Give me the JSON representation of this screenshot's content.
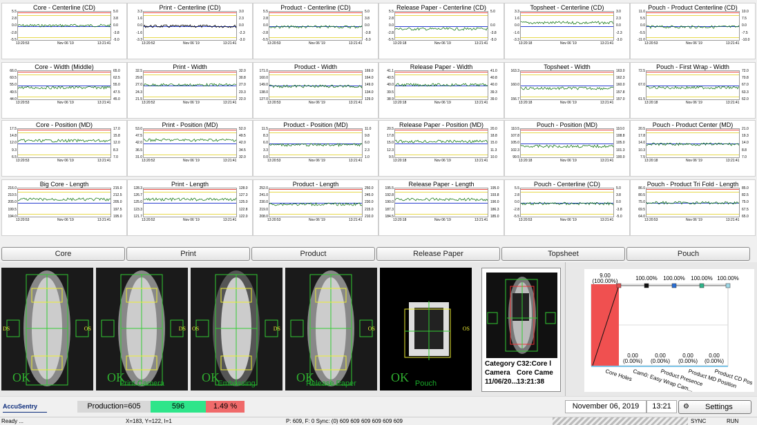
{
  "charts": [
    {
      "title": "Core - Centerline (CD)",
      "yl": [
        "5.5",
        "2.8",
        "0.0",
        "-2.8",
        "-5.5"
      ],
      "yr": [
        "5.0",
        "3.8",
        "0.0",
        "-3.8",
        "-5.0"
      ],
      "x0": "13:20:53",
      "xm": "Nov 06 '19",
      "x1": "13:21:41",
      "trace": "#1a7a1a"
    },
    {
      "title": "Print - Centerline (CD)",
      "yl": [
        "3.3",
        "1.6",
        "0.0",
        "-1.6",
        "-3.3"
      ],
      "yr": [
        "3.0",
        "2.3",
        "0.0",
        "-2.3",
        "-3.0"
      ],
      "x0": "13:20:52",
      "xm": "Nov 06 '19",
      "x1": "13:21:41",
      "trace": "#000000"
    },
    {
      "title": "Product - Centerline (CD)",
      "yl": [
        "5.5",
        "2.8",
        "0.0",
        "-2.8",
        "-5.5"
      ],
      "yr": [
        "5.0",
        "3.8",
        "0.0",
        "-3.8",
        "-5.0"
      ],
      "x0": "13:20:53",
      "xm": "Nov 06 '19",
      "x1": "13:21:41",
      "trace": "#1a7a1a"
    },
    {
      "title": "Release Paper - Centerline (CD)",
      "yl": [
        "5.5",
        "2.8",
        "0.0",
        "-2.8",
        "-5.5"
      ],
      "yr": [
        "5.0",
        "",
        "0.0",
        "-3.8",
        "-5.0"
      ],
      "x0": "13:20:18",
      "xm": "Nov 06 '19",
      "x1": "13:21:41",
      "trace": "#1a7a1a"
    },
    {
      "title": "Topsheet - Centerline (CD)",
      "yl": [
        "3.3",
        "1.6",
        "0.0",
        "-1.6",
        "-3.3"
      ],
      "yr": [
        "3.0",
        "2.3",
        "0.0",
        "-2.3",
        "-3.0"
      ],
      "x0": "13:20:18",
      "xm": "Nov 06 '19",
      "x1": "13:21:41",
      "trace": "#1a7a1a"
    },
    {
      "title": "Pouch - Product Centerline (CD)",
      "yl": [
        "11.0",
        "5.5",
        "0.0",
        "-5.5",
        "-11.0"
      ],
      "yr": [
        "10.0",
        "7.5",
        "0.0",
        "-7.5",
        "-10.0"
      ],
      "x0": "13:20:53",
      "xm": "Nov 06 '19",
      "x1": "13:21:41",
      "trace": "#1a7a1a"
    },
    {
      "title": "Core - Width (Middle)",
      "yl": [
        "66.0",
        "60.5",
        "55.0",
        "49.5",
        "44.0"
      ],
      "yr": [
        "65.0",
        "62.5",
        "55.0",
        "47.5",
        "45.0"
      ],
      "x0": "13:20:53",
      "xm": "Nov 06 '19",
      "x1": "13:21:41",
      "trace": "#1a7a1a"
    },
    {
      "title": "Print - Width",
      "yl": [
        "32.5",
        "29.8",
        "27.0",
        "24.3",
        "21.5"
      ],
      "yr": [
        "32.0",
        "30.8",
        "27.0",
        "23.3",
        "22.0"
      ],
      "x0": "13:20:52",
      "xm": "Nov 06 '19",
      "x1": "13:21:41",
      "trace": "#1a7a1a"
    },
    {
      "title": "Product - Width",
      "yl": [
        "171.0",
        "160.0",
        "149.0",
        "138.0",
        "127.0"
      ],
      "yr": [
        "169.0",
        "164.0",
        "149.0",
        "134.0",
        "129.0"
      ],
      "x0": "13:20:53",
      "xm": "Nov 06 '19",
      "x1": "13:21:41",
      "trace": "#1a7a1a"
    },
    {
      "title": "Release Paper - Width",
      "yl": [
        "41.1",
        "40.5",
        "40.0",
        "39.5",
        "38.9"
      ],
      "yr": [
        "41.0",
        "40.8",
        "40.0",
        "39.3",
        "39.0"
      ],
      "x0": "13:20:18",
      "xm": "Nov 06 '19",
      "x1": "13:21:41",
      "trace": "#1a7a1a"
    },
    {
      "title": "Topsheet - Width",
      "yl": [
        "163.3",
        "",
        "160.0",
        "",
        "156.7"
      ],
      "yr": [
        "163.0",
        "162.3",
        "160.0",
        "157.8",
        "157.0"
      ],
      "x0": "13:20:18",
      "xm": "Nov 06 '19",
      "x1": "13:21:41",
      "trace": "#1a7a1a"
    },
    {
      "title": "Pouch - First Wrap - Width",
      "yl": [
        "72.5",
        "",
        "67.0",
        "",
        "61.5"
      ],
      "yr": [
        "72.0",
        "70.8",
        "67.0",
        "63.3",
        "62.0"
      ],
      "x0": "13:20:18",
      "xm": "Nov 06 '19",
      "x1": "13:21:41",
      "trace": "#1a7a1a"
    },
    {
      "title": "Core - Position (MD)",
      "yl": [
        "17.5",
        "14.8",
        "12.0",
        "9.3",
        "6.5"
      ],
      "yr": [
        "17.0",
        "15.8",
        "12.0",
        "8.3",
        "7.0"
      ],
      "x0": "13:20:53",
      "xm": "Nov 06 '19",
      "x1": "13:21:41",
      "trace": "#1a7a1a"
    },
    {
      "title": "Print - Position (MD)",
      "yl": [
        "53.0",
        "47.5",
        "42.0",
        "36.5",
        "31.0"
      ],
      "yr": [
        "52.0",
        "49.5",
        "42.0",
        "34.5",
        "32.0"
      ],
      "x0": "13:20:52",
      "xm": "Nov 06 '19",
      "x1": "13:21:41",
      "trace": "#1a7a1a"
    },
    {
      "title": "Product - Position (MD)",
      "yl": [
        "11.5",
        "8.3",
        "6.0",
        "3.3",
        "0.0"
      ],
      "yr": [
        "11.0",
        "9.8",
        "6.0",
        "2.3",
        "1.0"
      ],
      "x0": "13:20:53",
      "xm": "Nov 06 '19",
      "x1": "13:21:41",
      "trace": "#1a7a1a"
    },
    {
      "title": "Release Paper - Position (MD)",
      "yl": [
        "20.5",
        "17.8",
        "15.0",
        "12.3",
        "9.5"
      ],
      "yr": [
        "20.0",
        "18.8",
        "15.0",
        "11.3",
        "10.0"
      ],
      "x0": "13:20:18",
      "xm": "Nov 06 '19",
      "x1": "13:21:41",
      "trace": "#1a7a1a"
    },
    {
      "title": "Pouch - Position (MD)",
      "yl": [
        "110.5",
        "107.8",
        "105.0",
        "102.3",
        "99.5"
      ],
      "yr": [
        "110.0",
        "108.8",
        "105.0",
        "101.3",
        "100.0"
      ],
      "x0": "13:20:18",
      "xm": "Nov 06 '19",
      "x1": "13:21:41",
      "trace": "#1a7a1a"
    },
    {
      "title": "Pouch - Product Center  (MD)",
      "yl": [
        "20.5",
        "17.8",
        "14.0",
        "10.3",
        "7.5"
      ],
      "yr": [
        "21.0",
        "19.3",
        "14.0",
        "8.8",
        "7.0"
      ],
      "x0": "13:20:18",
      "xm": "Nov 06 '19",
      "x1": "13:21:41",
      "trace": "#1a7a1a"
    },
    {
      "title": "Big Core - Length",
      "yl": [
        "216.0",
        "210.5",
        "205.0",
        "199.5",
        "194.0"
      ],
      "yr": [
        "215.0",
        "212.5",
        "205.0",
        "197.5",
        "195.0"
      ],
      "x0": "13:20:53",
      "xm": "Nov 06 '19",
      "x1": "13:21:41",
      "trace": "#1a7a1a"
    },
    {
      "title": "Print - Length",
      "yl": [
        "128.3",
        "126.7",
        "125.0",
        "123.3",
        "121.7"
      ],
      "yr": [
        "128.0",
        "127.3",
        "125.0",
        "122.8",
        "122.0"
      ],
      "x0": "13:20:52",
      "xm": "Nov 06 '19",
      "x1": "13:21:41",
      "trace": "#1a7a1a"
    },
    {
      "title": "Product - Length",
      "yl": [
        "252.0",
        "241.0",
        "230.0",
        "219.0",
        "208.0"
      ],
      "yr": [
        "250.0",
        "245.0",
        "230.0",
        "215.0",
        "210.0"
      ],
      "x0": "13:20:53",
      "xm": "Nov 06 '19",
      "x1": "13:21:41",
      "trace": "#1a7a1a"
    },
    {
      "title": "Release Paper - Length",
      "yl": [
        "195.5",
        "192.8",
        "190.0",
        "187.3",
        "184.5"
      ],
      "yr": [
        "195.0",
        "193.8",
        "190.0",
        "186.3",
        "185.0"
      ],
      "x0": "13:20:18",
      "xm": "Nov 06 '19",
      "x1": "13:21:41",
      "trace": "#1a7a1a"
    },
    {
      "title": "Pouch - Centerline (CD)",
      "yl": [
        "5.5",
        "2.8",
        "0.0",
        "-2.8",
        "-5.5"
      ],
      "yr": [
        "5.0",
        "3.8",
        "0.0",
        "-3.8",
        "-5.0"
      ],
      "x0": "13:20:53",
      "xm": "Nov 06 '19",
      "x1": "13:21:41",
      "trace": "#1a7a1a"
    },
    {
      "title": "Pouch - Product Tri Fold - Length",
      "yl": [
        "86.0",
        "80.5",
        "75.0",
        "69.5",
        "64.0"
      ],
      "yr": [
        "85.0",
        "82.5",
        "75.0",
        "67.5",
        "65.0"
      ],
      "x0": "13:20:53",
      "xm": "Nov 06 '19",
      "x1": "13:21:41",
      "trace": "#1a7a1a"
    }
  ],
  "tabs": [
    "Core",
    "Print",
    "Product",
    "Release Paper",
    "Topsheet",
    "Pouch"
  ],
  "cameras": [
    {
      "name": "",
      "status": "OK",
      "side_left": "DS",
      "side_right": "OS"
    },
    {
      "name": "Print Camera",
      "status": "OK",
      "side_left": "",
      "side_right": "DS"
    },
    {
      "name": "Embossing",
      "status": "OK",
      "side_left": "OS",
      "side_right": "DS"
    },
    {
      "name": "Release Paper",
      "status": "OK",
      "side_left": "",
      "side_right": "OS"
    },
    {
      "name": "Pouch",
      "status": "OK",
      "side_left": "",
      "side_right": "OS"
    }
  ],
  "detail": {
    "category_label": "Category",
    "category_value": "C32:Core l",
    "camera_label": "Camera",
    "camera_value": "Core Came",
    "date": "11/06/20...",
    "time": "13:21:38"
  },
  "summary_chart": {
    "categories": [
      "Core Holes",
      "Cam0: Easy Wrap Cam...",
      "Product Presence",
      "Product MD Position",
      "Product CD Pos"
    ],
    "top_labels": [
      "9.00\n(100.00%)",
      "100.00%",
      "100.00%",
      "100.00%",
      "100.00%"
    ],
    "bottom_labels": [
      "",
      "0.00\n(0.00%)",
      "0.00\n(0.00%)",
      "0.00\n(0.00%)",
      "0.00\n(0.00%)"
    ],
    "marker_colors": [
      "#e05050",
      "#111111",
      "#2a6fd6",
      "#2fb58a",
      "#9fd9e8"
    ]
  },
  "footer": {
    "logo": "AccuSentry",
    "production": "Production=605",
    "good": "596",
    "reject": "1.49 %",
    "date": "November 06, 2019",
    "time": "13:21",
    "settings": "Settings"
  },
  "status": {
    "ready": "Ready ...",
    "coords": "X=183, Y=122, I=1",
    "sync": "P: 609, F: 0 Sync: (0) 609 609 609 609 609 609",
    "sync_btn": "SYNC",
    "run_btn": "RUN"
  }
}
